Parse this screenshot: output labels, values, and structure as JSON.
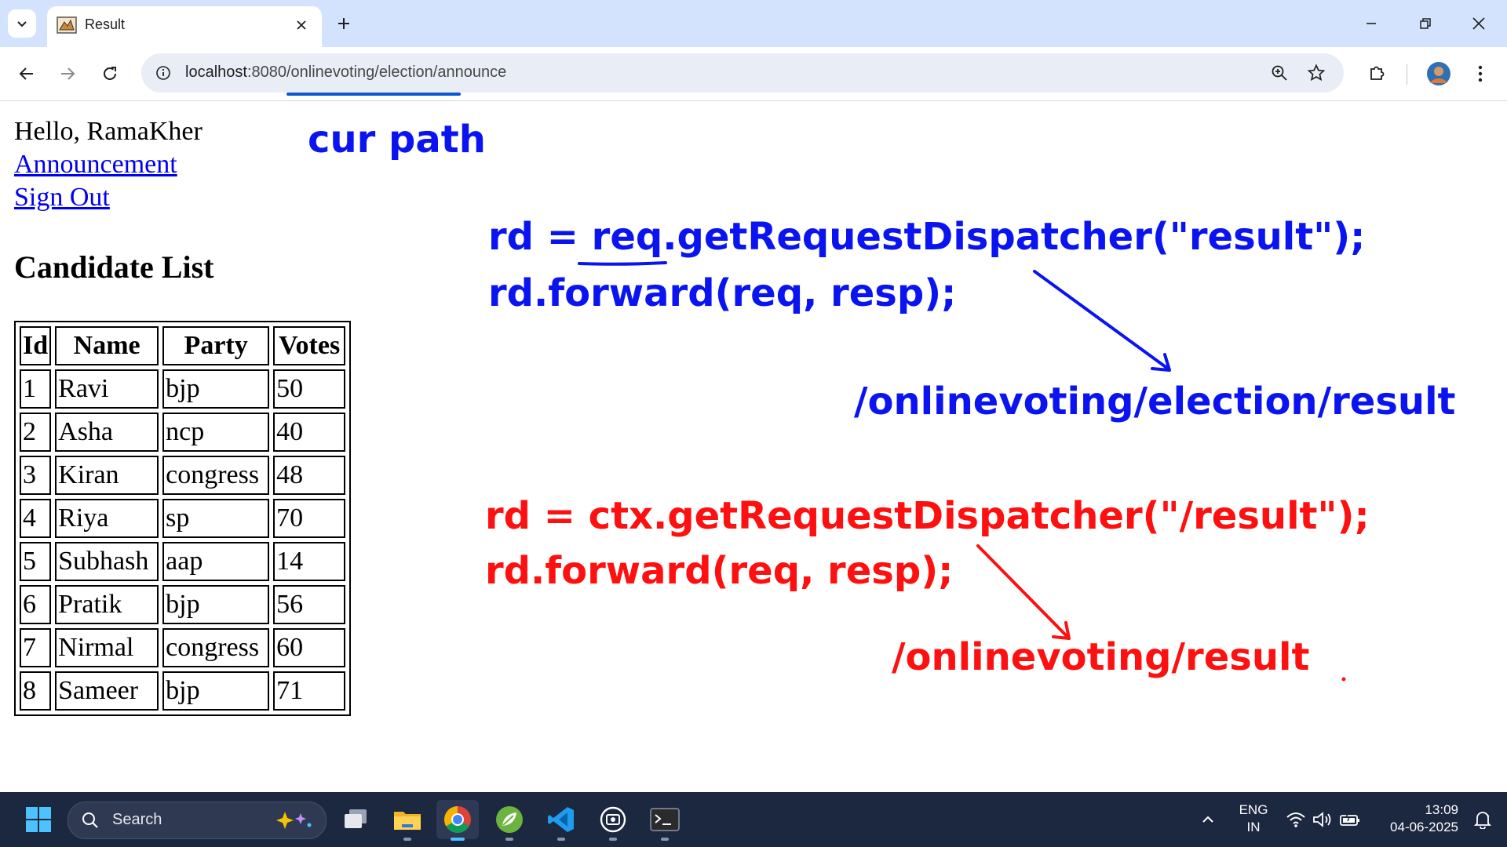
{
  "browser": {
    "tab_title": "Result",
    "url_host": "localhost",
    "url_path": ":8080/onlinevoting/election/announce"
  },
  "page": {
    "greeting": "Hello, RamaKher",
    "links": [
      "Announcement",
      "Sign Out"
    ],
    "heading": "Candidate List",
    "table": {
      "headers": [
        "Id",
        "Name",
        "Party",
        "Votes"
      ],
      "rows": [
        [
          "1",
          "Ravi",
          "bjp",
          "50"
        ],
        [
          "2",
          "Asha",
          "ncp",
          "40"
        ],
        [
          "3",
          "Kiran",
          "congress",
          "48"
        ],
        [
          "4",
          "Riya",
          "sp",
          "70"
        ],
        [
          "5",
          "Subhash",
          "aap",
          "14"
        ],
        [
          "6",
          "Pratik",
          "bjp",
          "56"
        ],
        [
          "7",
          "Nirmal",
          "congress",
          "60"
        ],
        [
          "8",
          "Sameer",
          "bjp",
          "71"
        ]
      ]
    }
  },
  "annotations": {
    "cur_path": "cur path",
    "blue_line1_prefix": "rd = ",
    "blue_line1_req": "req",
    "blue_line1_rest": ".getRequestDispatcher(\"result\");",
    "blue_line2": "rd.forward(req, resp);",
    "blue_result": "/onlinevoting/election/result",
    "red_line1": "rd = ctx.getRequestDispatcher(\"/result\");",
    "red_line2": "rd.forward(req, resp);",
    "red_result": "/onlinevoting/result",
    "colors": {
      "blue": "#0a14f0",
      "red": "#ff1010"
    }
  },
  "taskbar": {
    "search_placeholder": "Search",
    "lang_line1": "ENG",
    "lang_line2": "IN",
    "time": "13:09",
    "date": "04-06-2025"
  }
}
